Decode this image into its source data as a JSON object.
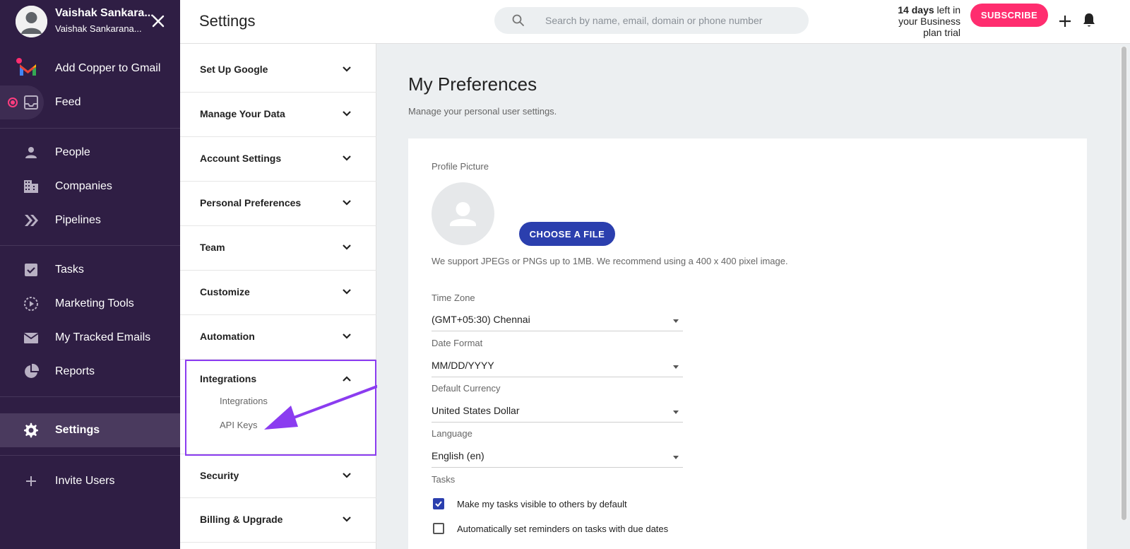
{
  "user": {
    "name": "Vaishak Sankara...",
    "email": "Vaishak Sankarana..."
  },
  "nav": {
    "add_copper": "Add Copper to Gmail",
    "feed": "Feed",
    "people": "People",
    "companies": "Companies",
    "pipelines": "Pipelines",
    "tasks": "Tasks",
    "marketing": "Marketing Tools",
    "tracked_emails": "My Tracked Emails",
    "reports": "Reports",
    "settings": "Settings",
    "invite": "Invite Users"
  },
  "header": {
    "title": "Settings",
    "search_placeholder": "Search by name, email, domain or phone number",
    "trial_bold": "14 days",
    "trial_rest_1": " left in",
    "trial_line_2": "your Business",
    "trial_line_3": "plan trial",
    "subscribe": "SUBSCRIBE"
  },
  "menu": {
    "setup_google": "Set Up Google",
    "manage_data": "Manage Your Data",
    "account_settings": "Account Settings",
    "personal_prefs": "Personal Preferences",
    "team": "Team",
    "customize": "Customize",
    "automation": "Automation",
    "integrations": "Integrations",
    "integrations_sub": "Integrations",
    "api_keys": "API Keys",
    "security": "Security",
    "billing": "Billing & Upgrade"
  },
  "main": {
    "title": "My Preferences",
    "subtitle": "Manage your personal user settings.",
    "profile_picture_label": "Profile Picture",
    "choose_file": "CHOOSE A FILE",
    "help_text": "We support JPEGs or PNGs up to 1MB. We recommend using a 400 x 400 pixel image.",
    "time_zone_label": "Time Zone",
    "time_zone_value": "(GMT+05:30) Chennai",
    "date_format_label": "Date Format",
    "date_format_value": "MM/DD/YYYY",
    "currency_label": "Default Currency",
    "currency_value": "United States Dollar",
    "language_label": "Language",
    "language_value": "English (en)",
    "tasks_label": "Tasks",
    "task_visible": "Make my tasks visible to others by default",
    "task_reminders": "Automatically set reminders on tasks with due dates"
  },
  "colors": {
    "sidebar_bg": "#2f1e44",
    "subscribe": "#ff2d6f",
    "primary_button": "#2b3fae",
    "highlight": "#8b3cf0"
  }
}
